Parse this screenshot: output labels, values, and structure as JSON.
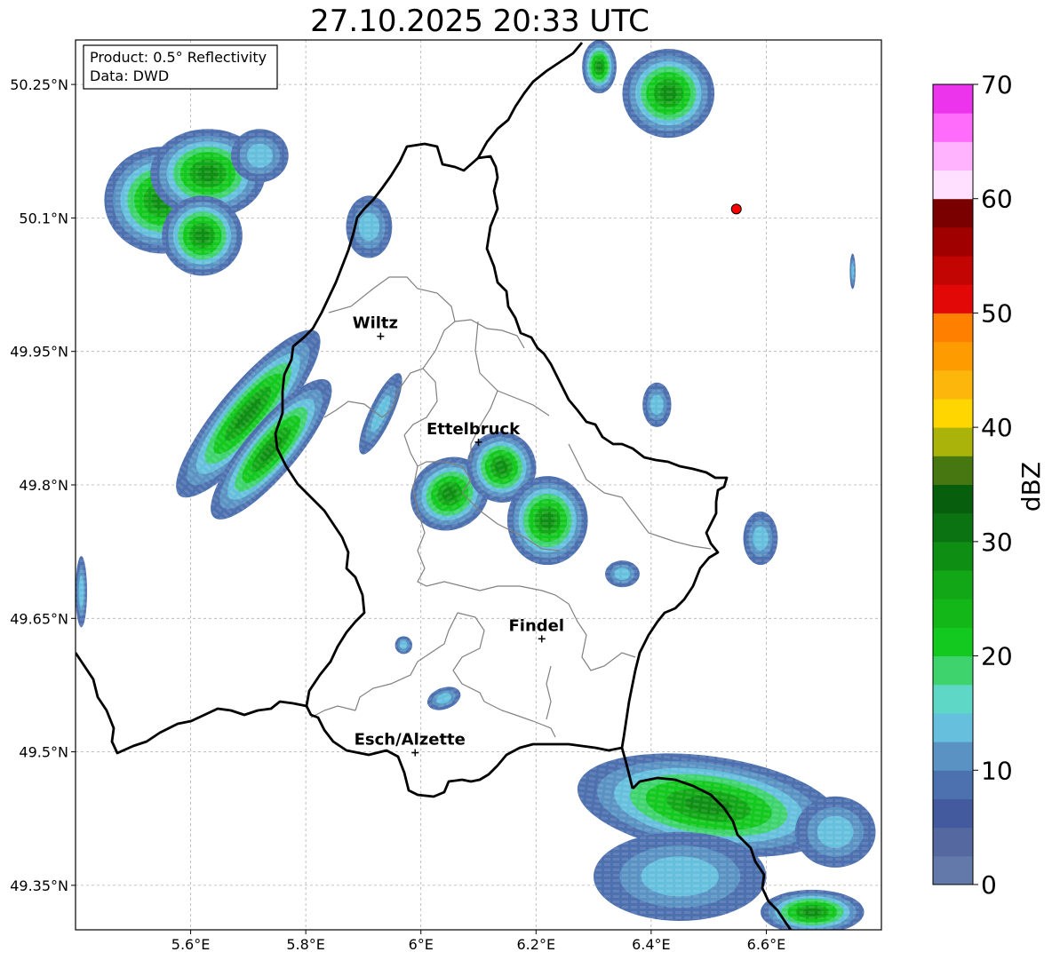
{
  "title": "27.10.2025 20:33 UTC",
  "info_box": {
    "product": "Product: 0.5° Reflectivity",
    "data": "Data: DWD"
  },
  "map": {
    "lon_range": [
      5.4,
      6.8
    ],
    "lat_range": [
      49.3,
      50.3
    ],
    "x_ticks": [
      {
        "value": 5.6,
        "label": "5.6°E"
      },
      {
        "value": 5.8,
        "label": "5.8°E"
      },
      {
        "value": 6.0,
        "label": "6°E"
      },
      {
        "value": 6.2,
        "label": "6.2°E"
      },
      {
        "value": 6.4,
        "label": "6.4°E"
      },
      {
        "value": 6.6,
        "label": "6.6°E"
      }
    ],
    "y_ticks": [
      {
        "value": 50.25,
        "label": "50.25°N"
      },
      {
        "value": 50.1,
        "label": "50.1°N"
      },
      {
        "value": 49.95,
        "label": "49.95°N"
      },
      {
        "value": 49.8,
        "label": "49.8°N"
      },
      {
        "value": 49.65,
        "label": "49.65°N"
      },
      {
        "value": 49.5,
        "label": "49.5°N"
      },
      {
        "value": 49.35,
        "label": "49.35°N"
      }
    ],
    "grid": true,
    "cities": [
      {
        "name": "Wiltz",
        "lon": 5.93,
        "lat": 49.967
      },
      {
        "name": "Ettelbruck",
        "lon": 6.1,
        "lat": 49.848
      },
      {
        "name": "Findel",
        "lon": 6.21,
        "lat": 49.627
      },
      {
        "name": "Esch/Alzette",
        "lon": 5.99,
        "lat": 49.499
      }
    ],
    "radar_site": {
      "lon": 6.548,
      "lat": 50.11,
      "color": "#ff0000"
    },
    "echo_cells": [
      {
        "lon": 5.55,
        "lat": 50.12,
        "rlon": 0.1,
        "rlat": 0.06,
        "ang": 0,
        "level": "green"
      },
      {
        "lon": 5.63,
        "lat": 50.15,
        "rlon": 0.1,
        "rlat": 0.05,
        "ang": 0,
        "level": "green"
      },
      {
        "lon": 5.62,
        "lat": 50.08,
        "rlon": 0.07,
        "rlat": 0.045,
        "ang": 0,
        "level": "green"
      },
      {
        "lon": 5.72,
        "lat": 50.17,
        "rlon": 0.05,
        "rlat": 0.03,
        "ang": 0,
        "level": "light"
      },
      {
        "lon": 5.91,
        "lat": 50.09,
        "rlon": 0.04,
        "rlat": 0.035,
        "ang": 0,
        "level": "light"
      },
      {
        "lon": 5.7,
        "lat": 49.88,
        "rlon": 0.05,
        "rlat": 0.12,
        "ang": 40,
        "level": "green"
      },
      {
        "lon": 5.74,
        "lat": 49.84,
        "rlon": 0.045,
        "rlat": 0.1,
        "ang": 40,
        "level": "green"
      },
      {
        "lon": 5.93,
        "lat": 49.88,
        "rlon": 0.02,
        "rlat": 0.05,
        "ang": 25,
        "level": "light"
      },
      {
        "lon": 6.05,
        "lat": 49.79,
        "rlon": 0.07,
        "rlat": 0.04,
        "ang": -30,
        "level": "green"
      },
      {
        "lon": 6.14,
        "lat": 49.82,
        "rlon": 0.06,
        "rlat": 0.04,
        "ang": -20,
        "level": "green"
      },
      {
        "lon": 6.22,
        "lat": 49.76,
        "rlon": 0.07,
        "rlat": 0.05,
        "ang": 0,
        "level": "green"
      },
      {
        "lon": 6.35,
        "lat": 49.7,
        "rlon": 0.03,
        "rlat": 0.015,
        "ang": 0,
        "level": "light"
      },
      {
        "lon": 6.41,
        "lat": 49.89,
        "rlon": 0.025,
        "rlat": 0.025,
        "ang": 0,
        "level": "light"
      },
      {
        "lon": 6.59,
        "lat": 49.74,
        "rlon": 0.03,
        "rlat": 0.03,
        "ang": 0,
        "level": "light"
      },
      {
        "lon": 6.43,
        "lat": 50.24,
        "rlon": 0.08,
        "rlat": 0.05,
        "ang": 0,
        "level": "green"
      },
      {
        "lon": 6.31,
        "lat": 50.27,
        "rlon": 0.03,
        "rlat": 0.03,
        "ang": 0,
        "level": "green"
      },
      {
        "lon": 6.04,
        "lat": 49.56,
        "rlon": 0.03,
        "rlat": 0.012,
        "ang": -20,
        "level": "light"
      },
      {
        "lon": 5.97,
        "lat": 49.62,
        "rlon": 0.015,
        "rlat": 0.01,
        "ang": 0,
        "level": "light"
      },
      {
        "lon": 6.5,
        "lat": 49.44,
        "rlon": 0.23,
        "rlat": 0.055,
        "ang": 8,
        "level": "green"
      },
      {
        "lon": 6.45,
        "lat": 49.36,
        "rlon": 0.15,
        "rlat": 0.05,
        "ang": 0,
        "level": "light"
      },
      {
        "lon": 6.68,
        "lat": 49.32,
        "rlon": 0.09,
        "rlat": 0.025,
        "ang": 0,
        "level": "green"
      },
      {
        "lon": 6.72,
        "lat": 49.41,
        "rlon": 0.07,
        "rlat": 0.04,
        "ang": 0,
        "level": "light"
      },
      {
        "lon": 5.41,
        "lat": 49.68,
        "rlon": 0.01,
        "rlat": 0.04,
        "ang": 0,
        "level": "light"
      },
      {
        "lon": 6.75,
        "lat": 50.04,
        "rlon": 0.005,
        "rlat": 0.02,
        "ang": 0,
        "level": "light"
      }
    ]
  },
  "colorbar": {
    "label": "dBZ",
    "min": 0,
    "max": 70,
    "ticks": [
      0,
      10,
      20,
      30,
      40,
      50,
      60,
      70
    ],
    "bin_width": 2.5,
    "colors": [
      "#6379a9",
      "#55689f",
      "#445a9f",
      "#4d70ae",
      "#5a93c3",
      "#66c0dd",
      "#5ed7c6",
      "#3fd36e",
      "#13c81f",
      "#13b718",
      "#11a716",
      "#0e8f13",
      "#0b7311",
      "#075f0e",
      "#467711",
      "#a9b30a",
      "#ffd600",
      "#fdb60b",
      "#fd9b00",
      "#ff7f00",
      "#e20808",
      "#c20403",
      "#a10000",
      "#7a0000",
      "#ffe0ff",
      "#ffb3ff",
      "#ff6bfb",
      "#ec34ed"
    ]
  }
}
